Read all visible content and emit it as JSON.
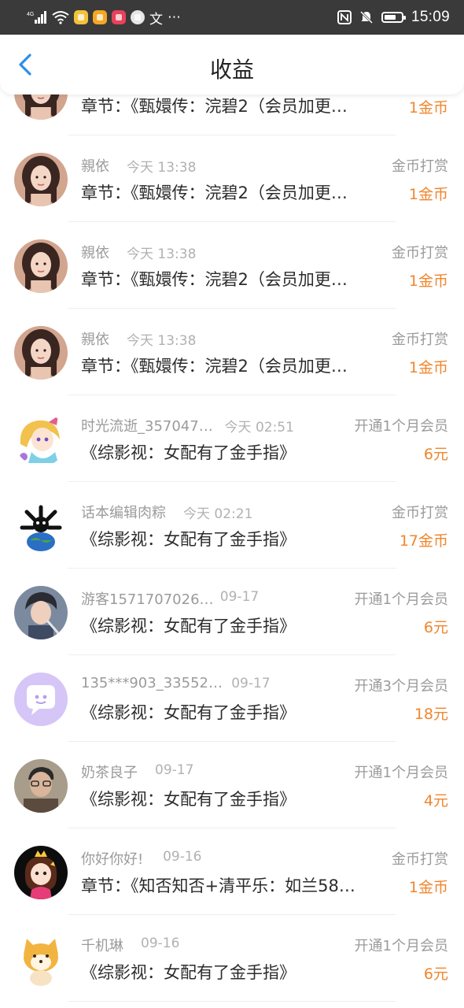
{
  "status_bar": {
    "network": "4G",
    "time": "15:09",
    "battery_level": 0.7,
    "extra_glyphs": [
      "文",
      "⋯"
    ]
  },
  "header": {
    "title": "收益"
  },
  "colors": {
    "accent_blue": "#2c8fe8",
    "amount_orange": "#f0862e"
  },
  "rows": [
    {
      "name": "",
      "time": "",
      "type": "",
      "desc": "章节：《甄嬛传：浣碧2（会员加更…",
      "amount": "1金币",
      "avatar": "girl-portrait"
    },
    {
      "name": "親依",
      "time": "今天 13:38",
      "type": "金币打赏",
      "desc": "章节：《甄嬛传：浣碧2（会员加更…",
      "amount": "1金币",
      "avatar": "girl-portrait"
    },
    {
      "name": "親依",
      "time": "今天 13:38",
      "type": "金币打赏",
      "desc": "章节：《甄嬛传：浣碧2（会员加更…",
      "amount": "1金币",
      "avatar": "girl-portrait"
    },
    {
      "name": "親依",
      "time": "今天 13:38",
      "type": "金币打赏",
      "desc": "章节：《甄嬛传：浣碧2（会员加更…",
      "amount": "1金币",
      "avatar": "girl-portrait"
    },
    {
      "name": "时光流逝_357047…",
      "time": "今天 02:51",
      "type": "开通1个月会员",
      "desc": "《综影视：女配有了金手指》",
      "amount": "6元",
      "avatar": "anime-girl"
    },
    {
      "name": "话本编辑肉粽",
      "time": "今天 02:21",
      "type": "金币打赏",
      "desc": "《综影视：女配有了金手指》",
      "amount": "17金币",
      "avatar": "earth-bones"
    },
    {
      "name": "游客1571707026…",
      "time": "09-17",
      "type": "开通1个月会员",
      "desc": "《综影视：女配有了金手指》",
      "amount": "6元",
      "avatar": "boy-portrait"
    },
    {
      "name": "135***903_33552…",
      "time": "09-17",
      "type": "开通3个月会员",
      "desc": "《综影视：女配有了金手指》",
      "amount": "18元",
      "avatar": "chat-bubble"
    },
    {
      "name": "奶茶良子",
      "time": "09-17",
      "type": "开通1个月会员",
      "desc": "《综影视：女配有了金手指》",
      "amount": "4元",
      "avatar": "man-portrait"
    },
    {
      "name": "你好你好!",
      "time": "09-16",
      "type": "金币打赏",
      "desc": "章节：《知否知否+清平乐：如兰58…",
      "amount": "1金币",
      "avatar": "cartoon-princess"
    },
    {
      "name": "千机琳",
      "time": "09-16",
      "type": "开通1个月会员",
      "desc": "《综影视：女配有了金手指》",
      "amount": "6元",
      "avatar": "shiba-dog"
    }
  ]
}
